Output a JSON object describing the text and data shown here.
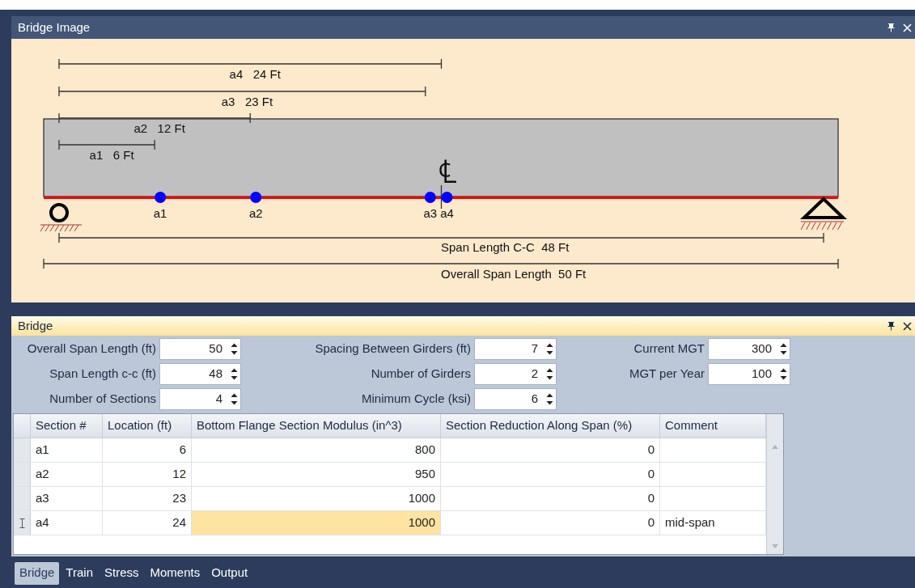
{
  "image_panel": {
    "title": "Bridge Image",
    "section_dims": [
      {
        "label": "a1   6 Ft"
      },
      {
        "label": "a2   12 Ft"
      },
      {
        "label": "a3   23 Ft"
      },
      {
        "label": "a4   24 Ft"
      }
    ],
    "point_labels": [
      "a1",
      "a2",
      "a3",
      "a4"
    ],
    "centerline": "℄",
    "span_dim": {
      "label": "Span Length C-C  48 Ft"
    },
    "overall_dim": {
      "label": "Overall Span Length  50 Ft"
    }
  },
  "bridge_panel": {
    "title": "Bridge",
    "fields": [
      {
        "label": "Overall Span Length (ft)",
        "value": "50"
      },
      {
        "label": "Spacing Between Girders (ft)",
        "value": "7"
      },
      {
        "label": "Current MGT",
        "value": "300"
      },
      {
        "label": "Span Length c-c (ft)",
        "value": "48"
      },
      {
        "label": "Number of Girders",
        "value": "2"
      },
      {
        "label": "MGT per Year",
        "value": "100"
      },
      {
        "label": "Number of Sections",
        "value": "4"
      },
      {
        "label": "Minimum Cycle (ksi)",
        "value": "6"
      }
    ],
    "table": {
      "columns": [
        "Section #",
        "Location (ft)",
        "Bottom Flange Section Modulus (in^3)",
        "Section Reduction Along Span (%)",
        "Comment"
      ],
      "rows": [
        {
          "editing": false,
          "cells": [
            {
              "text": "a1",
              "selected": false
            },
            {
              "text": "6",
              "selected": false
            },
            {
              "text": "800",
              "selected": false
            },
            {
              "text": "0",
              "selected": false
            },
            {
              "selected": false
            }
          ]
        },
        {
          "editing": false,
          "cells": [
            {
              "text": "a2",
              "selected": false
            },
            {
              "text": "12",
              "selected": false
            },
            {
              "text": "950",
              "selected": false
            },
            {
              "text": "0",
              "selected": false
            },
            {
              "selected": false
            }
          ]
        },
        {
          "editing": false,
          "cells": [
            {
              "text": "a3",
              "selected": false
            },
            {
              "text": "23",
              "selected": false
            },
            {
              "text": "1000",
              "selected": false
            },
            {
              "text": "0",
              "selected": false
            },
            {
              "selected": false
            }
          ]
        },
        {
          "editing": true,
          "cells": [
            {
              "text": "a4",
              "selected": false
            },
            {
              "text": "24",
              "selected": false
            },
            {
              "text": "1000",
              "selected": true
            },
            {
              "text": "0",
              "selected": false
            },
            {
              "text": "mid-span",
              "selected": false
            }
          ]
        }
      ]
    }
  },
  "tabs": [
    {
      "label": "Bridge",
      "selected": true
    },
    {
      "label": "Train",
      "selected": false
    },
    {
      "label": "Stress",
      "selected": false
    },
    {
      "label": "Moments",
      "selected": false
    },
    {
      "label": "Output",
      "selected": false
    }
  ]
}
